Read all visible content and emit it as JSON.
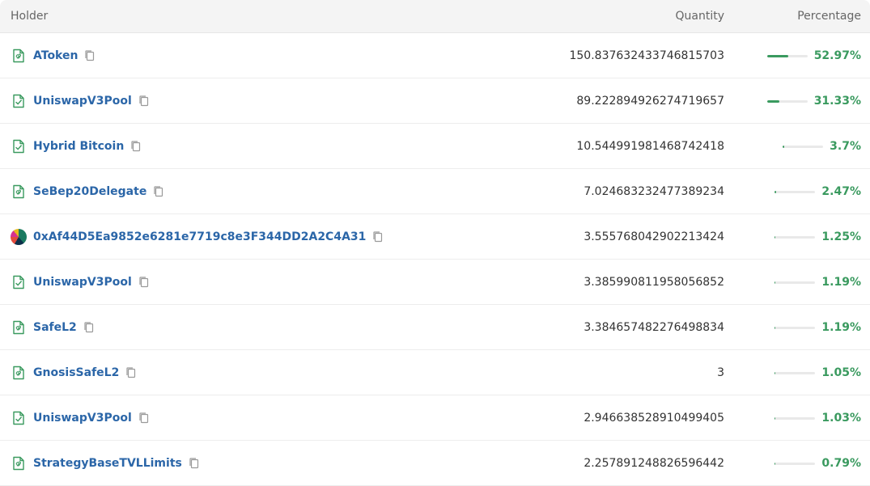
{
  "header": {
    "holder": "Holder",
    "quantity": "Quantity",
    "percentage": "Percentage"
  },
  "accent_color": "#3a9a5f",
  "link_color": "#2b66a8",
  "rows": [
    {
      "icon": "contract-file-icon",
      "name": "AToken",
      "quantity": "150.837632433746815703",
      "percentage": "52.97%",
      "fraction": 0.5297
    },
    {
      "icon": "verified-contract-icon",
      "name": "UniswapV3Pool",
      "quantity": "89.222894926274719657",
      "percentage": "31.33%",
      "fraction": 0.3133
    },
    {
      "icon": "verified-contract-icon",
      "name": "Hybrid Bitcoin",
      "quantity": "10.544991981468742418",
      "percentage": "3.7%",
      "fraction": 0.037
    },
    {
      "icon": "contract-file-icon",
      "name": "SeBep20Delegate",
      "quantity": "7.024683232477389234",
      "percentage": "2.47%",
      "fraction": 0.0247
    },
    {
      "icon": "avatar",
      "name": "0xAf44D5Ea9852e6281e7719c8e3F344DD2A2C4A31",
      "quantity": "3.555768042902213424",
      "percentage": "1.25%",
      "fraction": 0.0125
    },
    {
      "icon": "verified-contract-icon",
      "name": "UniswapV3Pool",
      "quantity": "3.385990811958056852",
      "percentage": "1.19%",
      "fraction": 0.0119
    },
    {
      "icon": "contract-file-icon",
      "name": "SafeL2",
      "quantity": "3.384657482276498834",
      "percentage": "1.19%",
      "fraction": 0.0119
    },
    {
      "icon": "contract-file-icon",
      "name": "GnosisSafeL2",
      "quantity": "3",
      "percentage": "1.05%",
      "fraction": 0.0105
    },
    {
      "icon": "verified-contract-icon",
      "name": "UniswapV3Pool",
      "quantity": "2.946638528910499405",
      "percentage": "1.03%",
      "fraction": 0.0103
    },
    {
      "icon": "contract-file-icon",
      "name": "StrategyBaseTVLLimits",
      "quantity": "2.257891248826596442",
      "percentage": "0.79%",
      "fraction": 0.0079
    }
  ]
}
